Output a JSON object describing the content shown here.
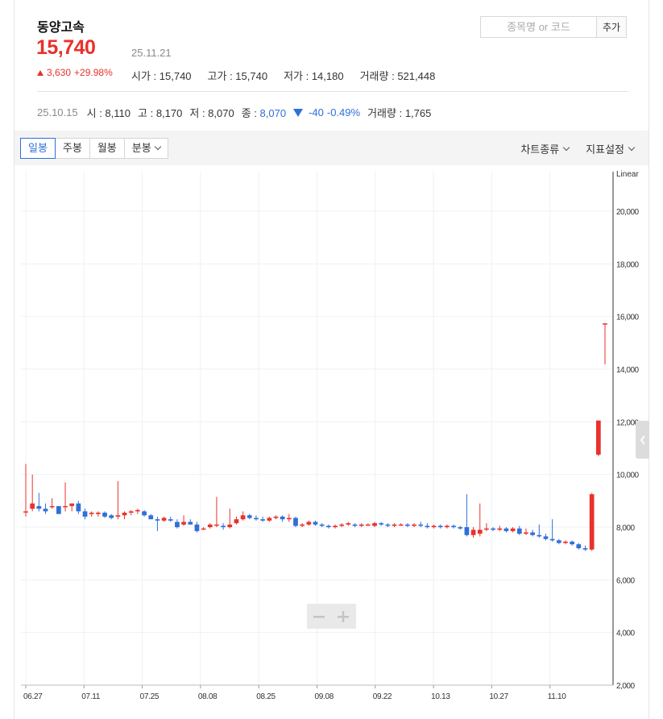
{
  "stock": {
    "name": "동양고속",
    "price": "15,740",
    "date": "25.11.21",
    "change_amount": "3,630",
    "change_pct": "+29.98%"
  },
  "stats": [
    {
      "label": "시가",
      "value": "15,740"
    },
    {
      "label": "고가",
      "value": "15,740"
    },
    {
      "label": "저가",
      "value": "14,180"
    },
    {
      "label": "거래량",
      "value": "521,448"
    }
  ],
  "search": {
    "placeholder": "종목명 or 코드",
    "add_label": "추가"
  },
  "previous": {
    "date": "25.10.15",
    "open_label": "시",
    "open": "8,110",
    "high_label": "고",
    "high": "8,170",
    "low_label": "저",
    "low": "8,070",
    "close_label": "종",
    "close": "8,070",
    "change": "-40",
    "change_pct": "-0.49%",
    "volume_label": "거래량",
    "volume": "1,765"
  },
  "toolbar": {
    "tabs": [
      "일봉",
      "주봉",
      "월봉",
      "분봉"
    ],
    "active_tab": "일봉",
    "chart_type_label": "차트종류",
    "indicator_label": "지표설정"
  },
  "colors": {
    "up": "#e8322b",
    "down": "#2f6fd8",
    "grid": "#eef1f6",
    "axis": "#333333"
  },
  "chart_data": {
    "type": "candlestick",
    "scale_label": "Linear",
    "ylim": [
      2000,
      21500
    ],
    "y_ticks": [
      "2,000",
      "4,000",
      "6,000",
      "8,000",
      "10,000",
      "12,000",
      "14,000",
      "16,000",
      "18,000",
      "20,000"
    ],
    "x_ticks": [
      "06.27",
      "07.11",
      "07.25",
      "08.08",
      "08.25",
      "09.08",
      "09.22",
      "10.13",
      "10.27",
      "11.10"
    ],
    "candles": [
      [
        8600,
        10400,
        8400,
        8600
      ],
      [
        8700,
        10000,
        8600,
        8900
      ],
      [
        8800,
        9300,
        8600,
        8700
      ],
      [
        8700,
        8900,
        8500,
        8600
      ],
      [
        8800,
        9100,
        8700,
        8800
      ],
      [
        8800,
        8800,
        8500,
        8500
      ],
      [
        8800,
        9700,
        8600,
        8800
      ],
      [
        8800,
        8900,
        8600,
        8900
      ],
      [
        8900,
        9000,
        8500,
        8600
      ],
      [
        8600,
        8700,
        8300,
        8400
      ],
      [
        8500,
        8600,
        8400,
        8550
      ],
      [
        8500,
        8600,
        8400,
        8550
      ],
      [
        8550,
        8600,
        8350,
        8400
      ],
      [
        8450,
        8500,
        8300,
        8350
      ],
      [
        8400,
        9750,
        8300,
        8450
      ],
      [
        8450,
        8600,
        8300,
        8550
      ],
      [
        8550,
        8650,
        8450,
        8600
      ],
      [
        8600,
        8700,
        8500,
        8650
      ],
      [
        8600,
        8650,
        8400,
        8450
      ],
      [
        8450,
        8500,
        8300,
        8300
      ],
      [
        8300,
        8400,
        7850,
        8250
      ],
      [
        8250,
        8400,
        8200,
        8350
      ],
      [
        8300,
        8400,
        8200,
        8250
      ],
      [
        8200,
        8300,
        7950,
        8000
      ],
      [
        8100,
        8450,
        8050,
        8200
      ],
      [
        8200,
        8300,
        8100,
        8100
      ],
      [
        8100,
        8200,
        7800,
        7850
      ],
      [
        7950,
        8000,
        7900,
        7950
      ],
      [
        8000,
        8150,
        7950,
        8100
      ],
      [
        8100,
        9150,
        8000,
        8100
      ],
      [
        8050,
        8150,
        7900,
        8000
      ],
      [
        8000,
        8700,
        7950,
        8100
      ],
      [
        8150,
        8400,
        8100,
        8300
      ],
      [
        8300,
        8600,
        8250,
        8450
      ],
      [
        8450,
        8500,
        8300,
        8350
      ],
      [
        8350,
        8450,
        8250,
        8300
      ],
      [
        8300,
        8400,
        8200,
        8250
      ],
      [
        8250,
        8400,
        8200,
        8350
      ],
      [
        8350,
        8450,
        8300,
        8400
      ],
      [
        8400,
        8450,
        8200,
        8300
      ],
      [
        8300,
        8500,
        8200,
        8350
      ],
      [
        8350,
        8400,
        8000,
        8050
      ],
      [
        8050,
        8150,
        8000,
        8100
      ],
      [
        8100,
        8250,
        8050,
        8200
      ],
      [
        8200,
        8250,
        8050,
        8100
      ],
      [
        8100,
        8150,
        8000,
        8050
      ],
      [
        8050,
        8100,
        7950,
        8000
      ],
      [
        8000,
        8100,
        7950,
        8050
      ],
      [
        8050,
        8150,
        8000,
        8100
      ],
      [
        8100,
        8200,
        8050,
        8150
      ],
      [
        8100,
        8150,
        8000,
        8050
      ],
      [
        8050,
        8150,
        8000,
        8100
      ],
      [
        8100,
        8150,
        8050,
        8100
      ],
      [
        8050,
        8200,
        8000,
        8150
      ],
      [
        8150,
        8200,
        8050,
        8100
      ],
      [
        8100,
        8150,
        8000,
        8050
      ],
      [
        8050,
        8150,
        8000,
        8100
      ],
      [
        8100,
        8150,
        8050,
        8100
      ],
      [
        8100,
        8150,
        8000,
        8050
      ],
      [
        8050,
        8150,
        8000,
        8100
      ],
      [
        8100,
        8200,
        8000,
        8050
      ],
      [
        8050,
        8150,
        7950,
        8000
      ],
      [
        8000,
        8100,
        7950,
        8050
      ],
      [
        8050,
        8100,
        7950,
        8000
      ],
      [
        8000,
        8100,
        7950,
        8050
      ],
      [
        8050,
        8100,
        7950,
        8000
      ],
      [
        8000,
        8050,
        7900,
        7950
      ],
      [
        8000,
        9250,
        7650,
        7700
      ],
      [
        7700,
        8000,
        7600,
        7900
      ],
      [
        7750,
        8900,
        7650,
        7900
      ],
      [
        7950,
        8150,
        7850,
        7950
      ],
      [
        7950,
        8000,
        7850,
        7900
      ],
      [
        7900,
        8050,
        7850,
        7950
      ],
      [
        7950,
        8000,
        7800,
        7850
      ],
      [
        7850,
        8000,
        7800,
        7950
      ],
      [
        7950,
        8050,
        7700,
        7750
      ],
      [
        7750,
        7950,
        7700,
        7800
      ],
      [
        7800,
        7900,
        7650,
        7700
      ],
      [
        7700,
        8100,
        7600,
        7650
      ],
      [
        7650,
        7750,
        7500,
        7550
      ],
      [
        7550,
        8300,
        7450,
        7500
      ],
      [
        7500,
        7550,
        7350,
        7400
      ],
      [
        7400,
        7500,
        7350,
        7450
      ],
      [
        7450,
        7500,
        7300,
        7350
      ],
      [
        7350,
        7400,
        7150,
        7200
      ],
      [
        7200,
        7300,
        7100,
        7150
      ],
      [
        7150,
        9300,
        7100,
        9250
      ],
      [
        10750,
        12050,
        10700,
        12050
      ],
      [
        15740,
        15740,
        14180,
        15740
      ]
    ]
  }
}
